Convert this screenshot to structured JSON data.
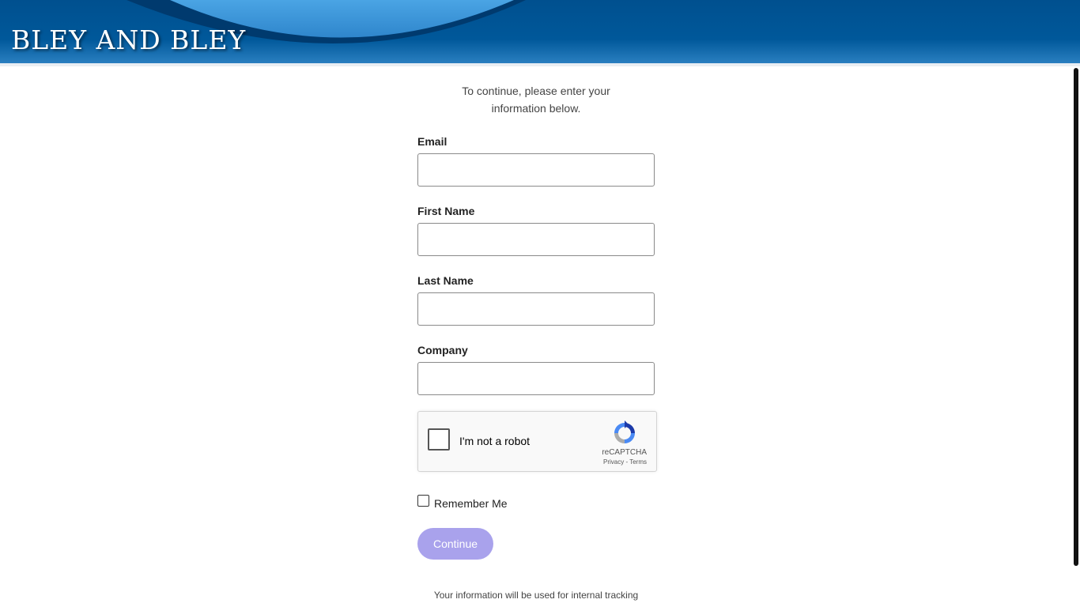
{
  "header": {
    "brand": "BLEY AND BLEY"
  },
  "form": {
    "intro_line1": "To continue, please enter your",
    "intro_line2": "information below.",
    "fields": [
      {
        "label": "Email",
        "value": "",
        "placeholder": ""
      },
      {
        "label": "First Name",
        "value": "",
        "placeholder": ""
      },
      {
        "label": "Last Name",
        "value": "",
        "placeholder": ""
      },
      {
        "label": "Company",
        "value": "",
        "placeholder": ""
      }
    ],
    "recaptcha": {
      "label": "I'm not a robot",
      "brand": "reCAPTCHA",
      "links": "Privacy - Terms",
      "checked": false
    },
    "remember_label": "Remember Me",
    "remember_checked": false,
    "continue_label": "Continue",
    "footer_note": "Your information will be used for internal tracking"
  },
  "colors": {
    "header_blue": "#00589a",
    "arc_blue": "#3a96d8",
    "button": "#a9a2ec",
    "recaptcha_blue": "#1c3aa9"
  }
}
